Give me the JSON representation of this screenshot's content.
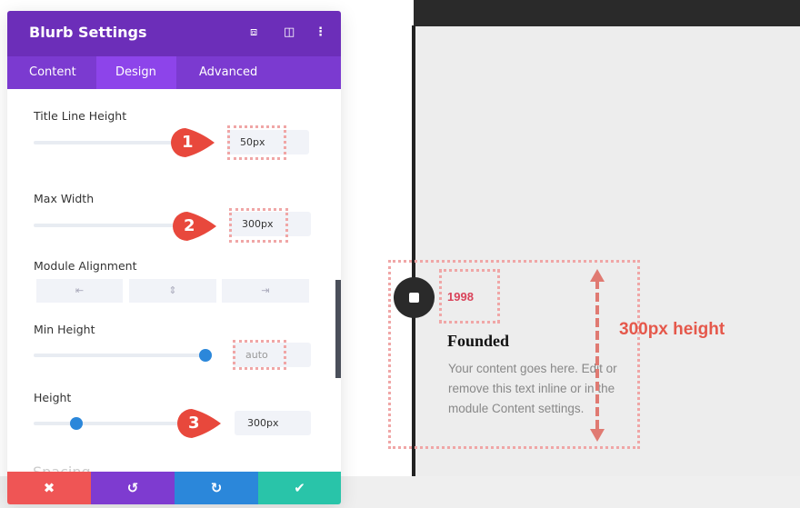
{
  "panel": {
    "title": "Blurb Settings",
    "header_icons": [
      "focus-icon",
      "split-view-icon",
      "more-icon"
    ],
    "tabs": [
      {
        "label": "Content"
      },
      {
        "label": "Design",
        "active": true
      },
      {
        "label": "Advanced"
      }
    ],
    "fields": {
      "title_line_height": {
        "label": "Title Line Height",
        "value": "50px",
        "callout": "1"
      },
      "max_width": {
        "label": "Max Width",
        "value": "300px",
        "callout": "2"
      },
      "module_alignment": {
        "label": "Module Alignment",
        "options": [
          "align-left-icon",
          "align-center-icon",
          "align-right-icon"
        ]
      },
      "min_height": {
        "label": "Min Height",
        "value": "auto"
      },
      "height": {
        "label": "Height",
        "value": "300px",
        "callout": "3"
      }
    },
    "next_section": "Spacing",
    "footer": {
      "cancel": "✖",
      "undo": "↺",
      "redo": "↻",
      "save": "✔"
    },
    "colors": {
      "header": "#6c2eb9",
      "tabs": "#7b3ad0",
      "cancel": "#ef5555",
      "undo": "#7e3bd0",
      "redo": "#2b87da",
      "save": "#29c4a9",
      "callout": "#e8483c"
    }
  },
  "preview": {
    "year": "1998",
    "title": "Founded",
    "body": "Your content goes here. Edit or remove this text inline or in the module Content settings.",
    "annotation": "300px height"
  }
}
